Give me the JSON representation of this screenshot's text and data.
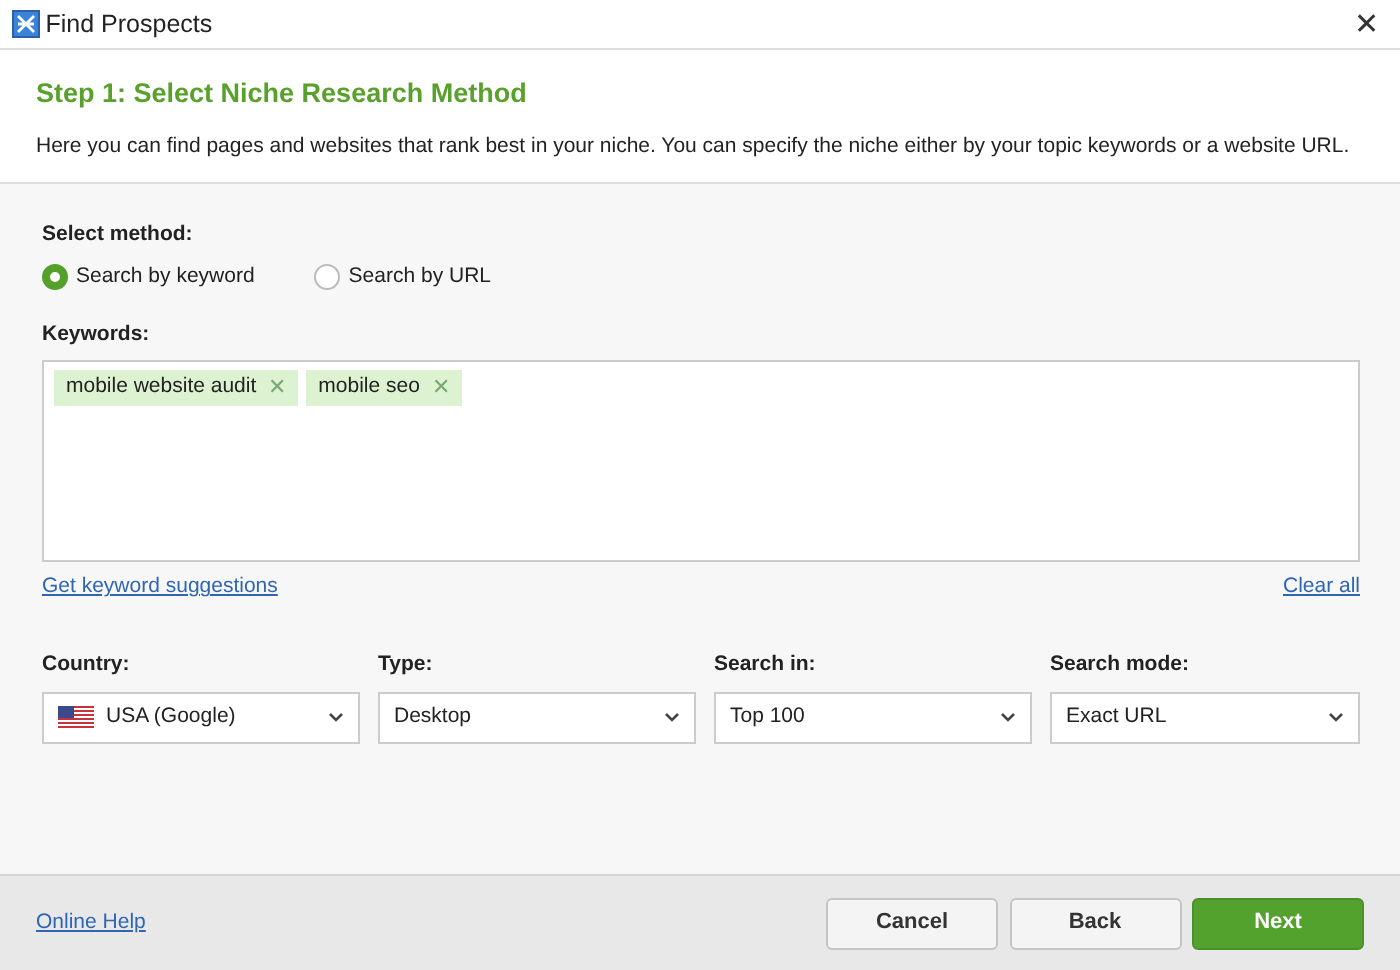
{
  "window": {
    "title": "Find Prospects",
    "close": "✕"
  },
  "header": {
    "title": "Step 1: Select Niche Research Method",
    "description": "Here you can find pages and websites that rank best in your niche. You can specify the niche either by your topic keywords or a website URL."
  },
  "method": {
    "label": "Select method:",
    "options": [
      {
        "label": "Search by keyword",
        "selected": true
      },
      {
        "label": "Search by URL",
        "selected": false
      }
    ]
  },
  "keywords": {
    "label": "Keywords:",
    "tags": [
      {
        "text": "mobile website audit",
        "remove": "✕"
      },
      {
        "text": "mobile seo",
        "remove": "✕"
      }
    ],
    "suggestions_link": "Get keyword suggestions",
    "clear_link": "Clear all"
  },
  "dropdowns": [
    {
      "label": "Country:",
      "value": "USA (Google)",
      "kind": "flag"
    },
    {
      "label": "Type:",
      "value": "Desktop",
      "kind": "plain"
    },
    {
      "label": "Search in:",
      "value": "Top 100",
      "kind": "plain"
    },
    {
      "label": "Search mode:",
      "value": "Exact URL",
      "kind": "plain"
    }
  ],
  "footer": {
    "help_link": "Online Help",
    "buttons": [
      {
        "label": "Cancel",
        "kind": "secondary"
      },
      {
        "label": "Back",
        "kind": "secondary"
      },
      {
        "label": "Next",
        "kind": "primary"
      }
    ]
  }
}
